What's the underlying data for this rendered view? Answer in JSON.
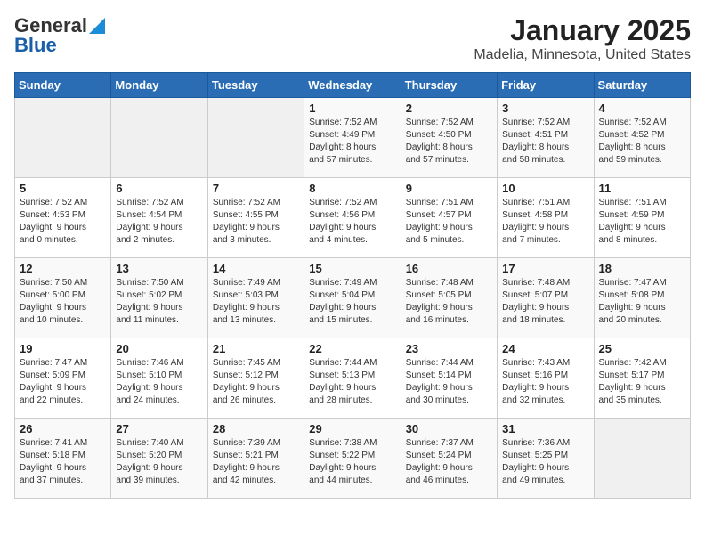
{
  "header": {
    "logo_general": "General",
    "logo_blue": "Blue",
    "title": "January 2025",
    "subtitle": "Madelia, Minnesota, United States"
  },
  "weekdays": [
    "Sunday",
    "Monday",
    "Tuesday",
    "Wednesday",
    "Thursday",
    "Friday",
    "Saturday"
  ],
  "weeks": [
    [
      {
        "day": "",
        "info": ""
      },
      {
        "day": "",
        "info": ""
      },
      {
        "day": "",
        "info": ""
      },
      {
        "day": "1",
        "info": "Sunrise: 7:52 AM\nSunset: 4:49 PM\nDaylight: 8 hours\nand 57 minutes."
      },
      {
        "day": "2",
        "info": "Sunrise: 7:52 AM\nSunset: 4:50 PM\nDaylight: 8 hours\nand 57 minutes."
      },
      {
        "day": "3",
        "info": "Sunrise: 7:52 AM\nSunset: 4:51 PM\nDaylight: 8 hours\nand 58 minutes."
      },
      {
        "day": "4",
        "info": "Sunrise: 7:52 AM\nSunset: 4:52 PM\nDaylight: 8 hours\nand 59 minutes."
      }
    ],
    [
      {
        "day": "5",
        "info": "Sunrise: 7:52 AM\nSunset: 4:53 PM\nDaylight: 9 hours\nand 0 minutes."
      },
      {
        "day": "6",
        "info": "Sunrise: 7:52 AM\nSunset: 4:54 PM\nDaylight: 9 hours\nand 2 minutes."
      },
      {
        "day": "7",
        "info": "Sunrise: 7:52 AM\nSunset: 4:55 PM\nDaylight: 9 hours\nand 3 minutes."
      },
      {
        "day": "8",
        "info": "Sunrise: 7:52 AM\nSunset: 4:56 PM\nDaylight: 9 hours\nand 4 minutes."
      },
      {
        "day": "9",
        "info": "Sunrise: 7:51 AM\nSunset: 4:57 PM\nDaylight: 9 hours\nand 5 minutes."
      },
      {
        "day": "10",
        "info": "Sunrise: 7:51 AM\nSunset: 4:58 PM\nDaylight: 9 hours\nand 7 minutes."
      },
      {
        "day": "11",
        "info": "Sunrise: 7:51 AM\nSunset: 4:59 PM\nDaylight: 9 hours\nand 8 minutes."
      }
    ],
    [
      {
        "day": "12",
        "info": "Sunrise: 7:50 AM\nSunset: 5:00 PM\nDaylight: 9 hours\nand 10 minutes."
      },
      {
        "day": "13",
        "info": "Sunrise: 7:50 AM\nSunset: 5:02 PM\nDaylight: 9 hours\nand 11 minutes."
      },
      {
        "day": "14",
        "info": "Sunrise: 7:49 AM\nSunset: 5:03 PM\nDaylight: 9 hours\nand 13 minutes."
      },
      {
        "day": "15",
        "info": "Sunrise: 7:49 AM\nSunset: 5:04 PM\nDaylight: 9 hours\nand 15 minutes."
      },
      {
        "day": "16",
        "info": "Sunrise: 7:48 AM\nSunset: 5:05 PM\nDaylight: 9 hours\nand 16 minutes."
      },
      {
        "day": "17",
        "info": "Sunrise: 7:48 AM\nSunset: 5:07 PM\nDaylight: 9 hours\nand 18 minutes."
      },
      {
        "day": "18",
        "info": "Sunrise: 7:47 AM\nSunset: 5:08 PM\nDaylight: 9 hours\nand 20 minutes."
      }
    ],
    [
      {
        "day": "19",
        "info": "Sunrise: 7:47 AM\nSunset: 5:09 PM\nDaylight: 9 hours\nand 22 minutes."
      },
      {
        "day": "20",
        "info": "Sunrise: 7:46 AM\nSunset: 5:10 PM\nDaylight: 9 hours\nand 24 minutes."
      },
      {
        "day": "21",
        "info": "Sunrise: 7:45 AM\nSunset: 5:12 PM\nDaylight: 9 hours\nand 26 minutes."
      },
      {
        "day": "22",
        "info": "Sunrise: 7:44 AM\nSunset: 5:13 PM\nDaylight: 9 hours\nand 28 minutes."
      },
      {
        "day": "23",
        "info": "Sunrise: 7:44 AM\nSunset: 5:14 PM\nDaylight: 9 hours\nand 30 minutes."
      },
      {
        "day": "24",
        "info": "Sunrise: 7:43 AM\nSunset: 5:16 PM\nDaylight: 9 hours\nand 32 minutes."
      },
      {
        "day": "25",
        "info": "Sunrise: 7:42 AM\nSunset: 5:17 PM\nDaylight: 9 hours\nand 35 minutes."
      }
    ],
    [
      {
        "day": "26",
        "info": "Sunrise: 7:41 AM\nSunset: 5:18 PM\nDaylight: 9 hours\nand 37 minutes."
      },
      {
        "day": "27",
        "info": "Sunrise: 7:40 AM\nSunset: 5:20 PM\nDaylight: 9 hours\nand 39 minutes."
      },
      {
        "day": "28",
        "info": "Sunrise: 7:39 AM\nSunset: 5:21 PM\nDaylight: 9 hours\nand 42 minutes."
      },
      {
        "day": "29",
        "info": "Sunrise: 7:38 AM\nSunset: 5:22 PM\nDaylight: 9 hours\nand 44 minutes."
      },
      {
        "day": "30",
        "info": "Sunrise: 7:37 AM\nSunset: 5:24 PM\nDaylight: 9 hours\nand 46 minutes."
      },
      {
        "day": "31",
        "info": "Sunrise: 7:36 AM\nSunset: 5:25 PM\nDaylight: 9 hours\nand 49 minutes."
      },
      {
        "day": "",
        "info": ""
      }
    ]
  ]
}
